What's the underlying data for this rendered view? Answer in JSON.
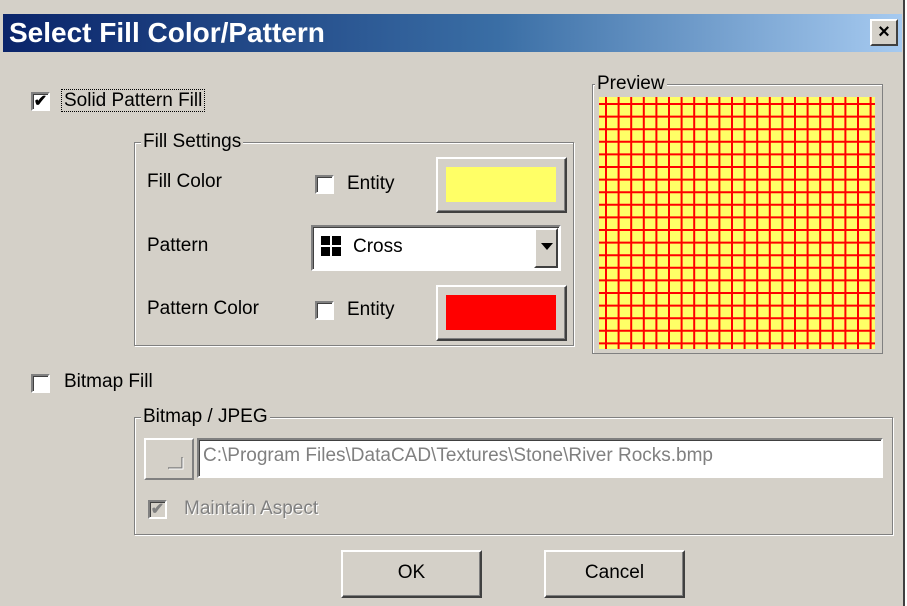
{
  "window": {
    "title": "Select Fill Color/Pattern",
    "close_label": "×"
  },
  "solid_fill": {
    "label": "Solid Pattern Fill",
    "checked": true,
    "check_mark": "✔"
  },
  "fill_settings": {
    "group_title": "Fill Settings",
    "fill_color_label": "Fill Color",
    "fill_entity_label": "Entity",
    "fill_color": "#ffff66",
    "pattern_label": "Pattern",
    "pattern_value": "Cross",
    "pattern_icon": "cross-pattern-icon",
    "pattern_color_label": "Pattern Color",
    "pattern_entity_label": "Entity",
    "pattern_color": "#ff0000"
  },
  "preview": {
    "title": "Preview",
    "background_color": "#ffff66",
    "line_color": "#ff0000"
  },
  "bitmap_fill": {
    "label": "Bitmap Fill",
    "checked": false
  },
  "bitmap": {
    "group_title": "Bitmap / JPEG",
    "path": "C:\\Program Files\\DataCAD\\Textures\\Stone\\River Rocks.bmp",
    "maintain_aspect_label": "Maintain Aspect",
    "maintain_aspect_checked": true,
    "check_mark": "✔"
  },
  "buttons": {
    "ok": "OK",
    "cancel": "Cancel"
  }
}
